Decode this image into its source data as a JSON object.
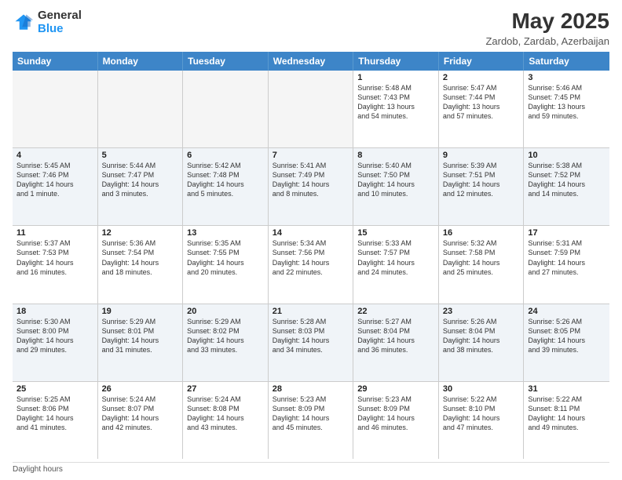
{
  "header": {
    "logo_line1": "General",
    "logo_line2": "Blue",
    "month_year": "May 2025",
    "location": "Zardob, Zardab, Azerbaijan"
  },
  "days_of_week": [
    "Sunday",
    "Monday",
    "Tuesday",
    "Wednesday",
    "Thursday",
    "Friday",
    "Saturday"
  ],
  "footer": {
    "note": "Daylight hours"
  },
  "weeks": [
    [
      {
        "day": "",
        "content": ""
      },
      {
        "day": "",
        "content": ""
      },
      {
        "day": "",
        "content": ""
      },
      {
        "day": "",
        "content": ""
      },
      {
        "day": "1",
        "content": "Sunrise: 5:48 AM\nSunset: 7:43 PM\nDaylight: 13 hours\nand 54 minutes."
      },
      {
        "day": "2",
        "content": "Sunrise: 5:47 AM\nSunset: 7:44 PM\nDaylight: 13 hours\nand 57 minutes."
      },
      {
        "day": "3",
        "content": "Sunrise: 5:46 AM\nSunset: 7:45 PM\nDaylight: 13 hours\nand 59 minutes."
      }
    ],
    [
      {
        "day": "4",
        "content": "Sunrise: 5:45 AM\nSunset: 7:46 PM\nDaylight: 14 hours\nand 1 minute."
      },
      {
        "day": "5",
        "content": "Sunrise: 5:44 AM\nSunset: 7:47 PM\nDaylight: 14 hours\nand 3 minutes."
      },
      {
        "day": "6",
        "content": "Sunrise: 5:42 AM\nSunset: 7:48 PM\nDaylight: 14 hours\nand 5 minutes."
      },
      {
        "day": "7",
        "content": "Sunrise: 5:41 AM\nSunset: 7:49 PM\nDaylight: 14 hours\nand 8 minutes."
      },
      {
        "day": "8",
        "content": "Sunrise: 5:40 AM\nSunset: 7:50 PM\nDaylight: 14 hours\nand 10 minutes."
      },
      {
        "day": "9",
        "content": "Sunrise: 5:39 AM\nSunset: 7:51 PM\nDaylight: 14 hours\nand 12 minutes."
      },
      {
        "day": "10",
        "content": "Sunrise: 5:38 AM\nSunset: 7:52 PM\nDaylight: 14 hours\nand 14 minutes."
      }
    ],
    [
      {
        "day": "11",
        "content": "Sunrise: 5:37 AM\nSunset: 7:53 PM\nDaylight: 14 hours\nand 16 minutes."
      },
      {
        "day": "12",
        "content": "Sunrise: 5:36 AM\nSunset: 7:54 PM\nDaylight: 14 hours\nand 18 minutes."
      },
      {
        "day": "13",
        "content": "Sunrise: 5:35 AM\nSunset: 7:55 PM\nDaylight: 14 hours\nand 20 minutes."
      },
      {
        "day": "14",
        "content": "Sunrise: 5:34 AM\nSunset: 7:56 PM\nDaylight: 14 hours\nand 22 minutes."
      },
      {
        "day": "15",
        "content": "Sunrise: 5:33 AM\nSunset: 7:57 PM\nDaylight: 14 hours\nand 24 minutes."
      },
      {
        "day": "16",
        "content": "Sunrise: 5:32 AM\nSunset: 7:58 PM\nDaylight: 14 hours\nand 25 minutes."
      },
      {
        "day": "17",
        "content": "Sunrise: 5:31 AM\nSunset: 7:59 PM\nDaylight: 14 hours\nand 27 minutes."
      }
    ],
    [
      {
        "day": "18",
        "content": "Sunrise: 5:30 AM\nSunset: 8:00 PM\nDaylight: 14 hours\nand 29 minutes."
      },
      {
        "day": "19",
        "content": "Sunrise: 5:29 AM\nSunset: 8:01 PM\nDaylight: 14 hours\nand 31 minutes."
      },
      {
        "day": "20",
        "content": "Sunrise: 5:29 AM\nSunset: 8:02 PM\nDaylight: 14 hours\nand 33 minutes."
      },
      {
        "day": "21",
        "content": "Sunrise: 5:28 AM\nSunset: 8:03 PM\nDaylight: 14 hours\nand 34 minutes."
      },
      {
        "day": "22",
        "content": "Sunrise: 5:27 AM\nSunset: 8:04 PM\nDaylight: 14 hours\nand 36 minutes."
      },
      {
        "day": "23",
        "content": "Sunrise: 5:26 AM\nSunset: 8:04 PM\nDaylight: 14 hours\nand 38 minutes."
      },
      {
        "day": "24",
        "content": "Sunrise: 5:26 AM\nSunset: 8:05 PM\nDaylight: 14 hours\nand 39 minutes."
      }
    ],
    [
      {
        "day": "25",
        "content": "Sunrise: 5:25 AM\nSunset: 8:06 PM\nDaylight: 14 hours\nand 41 minutes."
      },
      {
        "day": "26",
        "content": "Sunrise: 5:24 AM\nSunset: 8:07 PM\nDaylight: 14 hours\nand 42 minutes."
      },
      {
        "day": "27",
        "content": "Sunrise: 5:24 AM\nSunset: 8:08 PM\nDaylight: 14 hours\nand 43 minutes."
      },
      {
        "day": "28",
        "content": "Sunrise: 5:23 AM\nSunset: 8:09 PM\nDaylight: 14 hours\nand 45 minutes."
      },
      {
        "day": "29",
        "content": "Sunrise: 5:23 AM\nSunset: 8:09 PM\nDaylight: 14 hours\nand 46 minutes."
      },
      {
        "day": "30",
        "content": "Sunrise: 5:22 AM\nSunset: 8:10 PM\nDaylight: 14 hours\nand 47 minutes."
      },
      {
        "day": "31",
        "content": "Sunrise: 5:22 AM\nSunset: 8:11 PM\nDaylight: 14 hours\nand 49 minutes."
      }
    ]
  ]
}
